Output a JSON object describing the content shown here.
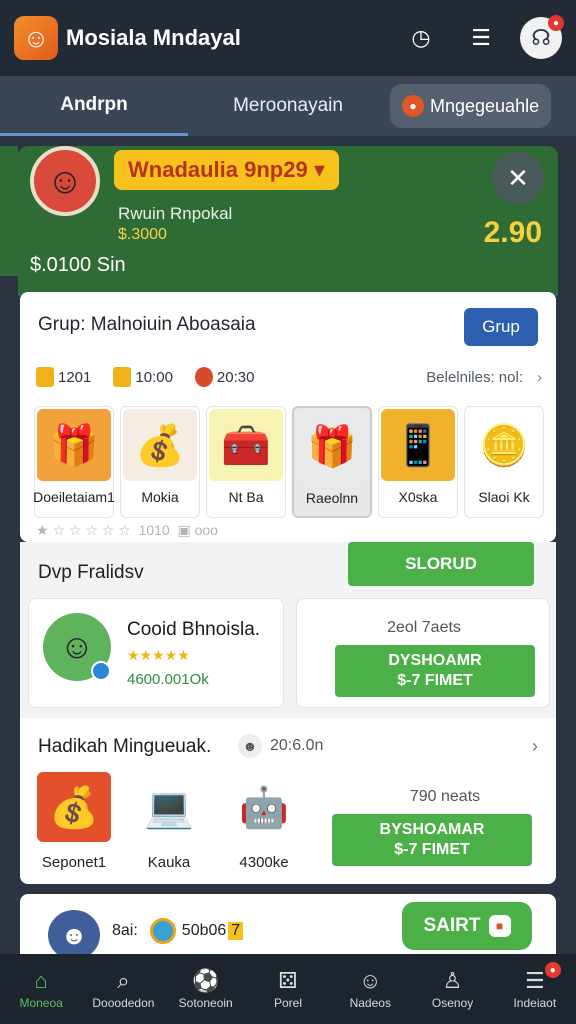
{
  "app": {
    "title": "Mosiala Mndayal",
    "icon": "app-avatar-icon"
  },
  "top_icons": [
    "clock-icon",
    "menu-icon",
    "notification-icon"
  ],
  "tabs": [
    {
      "label": "Andrpn",
      "active": true
    },
    {
      "label": "Meroonayain",
      "active": false
    },
    {
      "label": "Mngegeuahle",
      "active": false
    }
  ],
  "hero": {
    "badge": "Wnadaulia 9np29",
    "name": "Rwuin Rnpokal",
    "sub": "$.3000",
    "balance": "$.0100 Sin",
    "amount": "2.90"
  },
  "group": {
    "title": "Grup: Malnoiuin Aboasaia",
    "button": "Grup",
    "stats": [
      "1201",
      "10:00",
      "20:30"
    ],
    "stats_more": "Belelniles: nol:",
    "tiles": [
      {
        "label": "Doeiletaiam1",
        "icon": "gift-box-icon",
        "color": "#f2a23a"
      },
      {
        "label": "Mokia",
        "icon": "treasure-icon",
        "color": "#f3ede2"
      },
      {
        "label": "Nt Ba",
        "icon": "machine-icon",
        "color": "#f8f3b0"
      },
      {
        "label": "Raeolnn",
        "icon": "gift-icon",
        "color": "#e9eaec"
      },
      {
        "label": "X0ska",
        "icon": "tablet-icon",
        "color": "#f0b22a"
      },
      {
        "label": "Slaoi Kk",
        "icon": "gold-icon",
        "color": "#ffffff"
      }
    ],
    "rating_text": "1010",
    "rating_suffix": "ooo"
  },
  "strip": {
    "title": "Dvp Fralidsv",
    "button": "SLORUD",
    "promo_name": "Cooid Bhnoisla.",
    "promo_value": "4600.001Ok",
    "right_top": "2eol 7aets",
    "right_btn_line1": "DYSHOAMR",
    "right_btn_line2": "$-7 FIMET"
  },
  "highlight": {
    "title": "Hadikah Mingueuak.",
    "extra": "20:6.0n",
    "items": [
      {
        "label": "Seponet1",
        "icon": "treasure-chest-icon",
        "color": "#e3502c"
      },
      {
        "label": "Kauka",
        "icon": "laptop-icon",
        "color": "#ffffff"
      },
      {
        "label": "4300ke",
        "icon": "robot-icon",
        "color": "#ffffff"
      }
    ],
    "right_top": "790 neats",
    "right_btn_line1": "BYSHOAMAR",
    "right_btn_line2": "$-7 FIMET"
  },
  "last": {
    "text": "8ai:",
    "value": "50b06",
    "badge": "7",
    "button": "SAIRT"
  },
  "nav": [
    {
      "label": "Moneoa",
      "icon": "home-icon",
      "active": true
    },
    {
      "label": "Dooodedon",
      "icon": "search-icon",
      "active": false
    },
    {
      "label": "Sotoneoin",
      "icon": "ball-icon",
      "active": false
    },
    {
      "label": "Porel",
      "icon": "dice-icon",
      "active": false
    },
    {
      "label": "Nadeos",
      "icon": "group-icon",
      "active": false
    },
    {
      "label": "Osenoy",
      "icon": "user-icon",
      "active": false
    },
    {
      "label": "Indeiaot",
      "icon": "list-icon",
      "active": false
    }
  ]
}
